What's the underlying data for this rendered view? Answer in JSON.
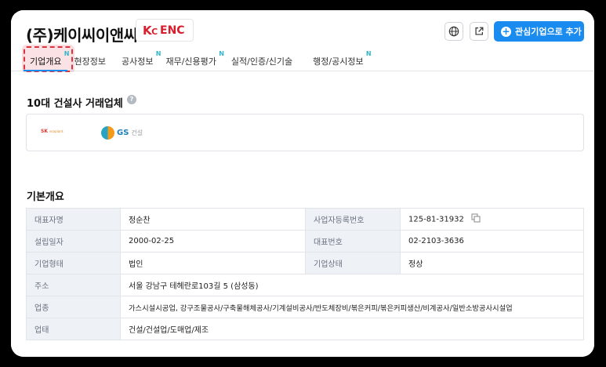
{
  "company": {
    "name": "(주)케이씨이앤씨",
    "logo_text": "KCENC"
  },
  "header_actions": {
    "globe_icon": "globe-icon",
    "external_icon": "external-link-icon",
    "follow_label": "관심기업으로 추가"
  },
  "tabs": [
    {
      "label": "기업개요",
      "new": true,
      "active": true
    },
    {
      "label": "현장정보",
      "new": false,
      "active": false
    },
    {
      "label": "공사정보",
      "new": true,
      "active": false
    },
    {
      "label": "재무/신용평가",
      "new": true,
      "active": false
    },
    {
      "label": "실적/인증/신기술",
      "new": false,
      "active": false
    },
    {
      "label": "행정/공시정보",
      "new": true,
      "active": false
    }
  ],
  "new_badge": "N",
  "partners_section": {
    "title": "10대 건설사 거래업체",
    "help": "?",
    "partners": [
      {
        "name": "SK ecoplant",
        "brand": "SK",
        "sub": "ecoplant"
      },
      {
        "name": "GS건설",
        "brand": "GS",
        "sub": "건설"
      }
    ]
  },
  "overview": {
    "title": "기본개요",
    "rows": [
      {
        "label": "대표자명",
        "value": "정순찬",
        "label2": "사업자등록번호",
        "value2": "125-81-31932"
      },
      {
        "label": "설립일자",
        "value": "2000-02-25",
        "label2": "대표번호",
        "value2": "02-2103-3636"
      },
      {
        "label": "기업형태",
        "value": "법인",
        "label2": "기업상태",
        "value2": "정상"
      },
      {
        "label": "주소",
        "value": "서울 강남구 테헤란로103길 5 (삼성동)"
      },
      {
        "label": "업종",
        "value": "가스시설시공업, 강구조물공사/구축물해체공사/기계설비공사/반도체장비/볶은커피/볶은커피생산/비계공사/일반소방공사시설업"
      },
      {
        "label": "업태",
        "value": "건설/건설업/도매업/제조"
      }
    ]
  }
}
